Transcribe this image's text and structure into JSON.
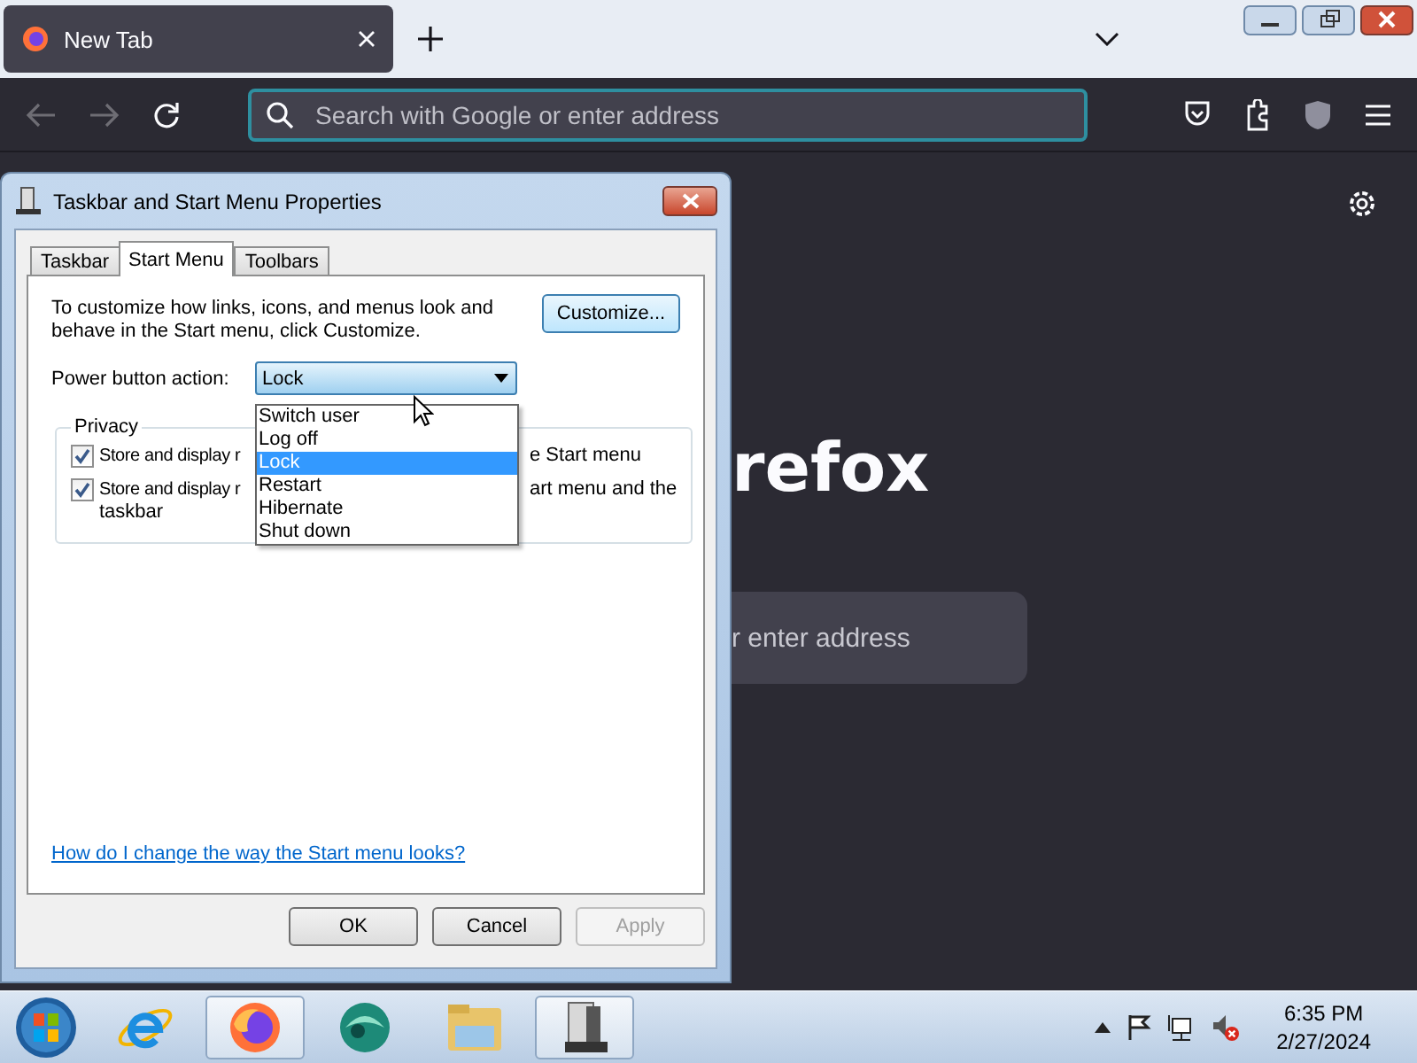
{
  "browser": {
    "tab": {
      "title": "New Tab",
      "selected": true
    },
    "urlbar": {
      "placeholder": "Search with Google or enter address"
    },
    "content": {
      "logo_text": "refox",
      "search_placeholder": "r enter address"
    }
  },
  "dialog": {
    "title": "Taskbar and Start Menu Properties",
    "tabs": [
      {
        "label": "Taskbar",
        "selected": false
      },
      {
        "label": "Start Menu",
        "selected": true
      },
      {
        "label": "Toolbars",
        "selected": false
      }
    ],
    "description": "To customize how links, icons, and menus look and behave in the Start menu, click Customize.",
    "customize_button": "Customize...",
    "power_label": "Power button action:",
    "power_combo": {
      "value": "Lock",
      "expanded": true
    },
    "power_options": [
      {
        "label": "Switch user",
        "selected": false
      },
      {
        "label": "Log off",
        "selected": false
      },
      {
        "label": "Lock",
        "selected": true
      },
      {
        "label": "Restart",
        "selected": false
      },
      {
        "label": "Hibernate",
        "selected": false
      },
      {
        "label": "Shut down",
        "selected": false
      }
    ],
    "privacy": {
      "legend": "Privacy",
      "items": [
        {
          "checked": true,
          "text_left": "Store and display r",
          "text_right": "e Start menu"
        },
        {
          "checked": true,
          "text_left": "Store and display r",
          "text_right": "art menu and the",
          "text_wrap": "taskbar"
        }
      ]
    },
    "help_link": "How do I change the way the Start menu looks?",
    "buttons": [
      {
        "label": "OK",
        "disabled": false
      },
      {
        "label": "Cancel",
        "disabled": false
      },
      {
        "label": "Apply",
        "disabled": true
      }
    ]
  },
  "taskbar": {
    "items": [
      {
        "kind": "start",
        "active": false
      },
      {
        "kind": "ie",
        "active": false
      },
      {
        "kind": "firefox",
        "active": true
      },
      {
        "kind": "app",
        "active": false
      },
      {
        "kind": "explorer",
        "active": false
      },
      {
        "kind": "properties",
        "active": true
      }
    ],
    "clock": {
      "time": "6:35 PM",
      "date": "2/27/2024"
    }
  }
}
